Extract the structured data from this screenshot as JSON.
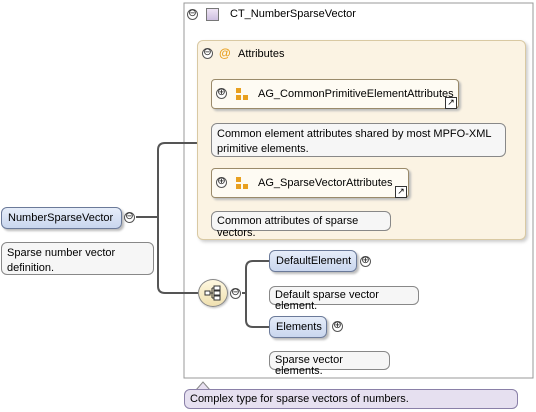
{
  "root": {
    "label": "NumberSparseVector",
    "note": "Sparse number vector definition."
  },
  "complex_type": {
    "label": "CT_NumberSparseVector",
    "note": "Complex type for sparse vectors of numbers."
  },
  "attributes": {
    "label": "Attributes",
    "groups": [
      {
        "label": "AG_CommonPrimitiveElementAttributes",
        "note": "Common element attributes shared by most MPFO-XML primitive elements."
      },
      {
        "label": "AG_SparseVectorAttributes",
        "note": "Common attributes of sparse vectors."
      }
    ]
  },
  "sequence": {
    "elements": [
      {
        "label": "DefaultElement",
        "note": "Default sparse vector element."
      },
      {
        "label": "Elements",
        "note": "Sparse vector elements."
      }
    ]
  },
  "symbols": {
    "collapse": "⊖",
    "expand": "⊕",
    "attribute_at": "@",
    "link_arrow": "↗",
    "sequence_icon": "sequence-icon"
  },
  "colors": {
    "node_fill": "#d5e0f3",
    "attr_panel": "#fbf3e3",
    "attr_border": "#d9c9a3",
    "square": "#e8a020"
  }
}
